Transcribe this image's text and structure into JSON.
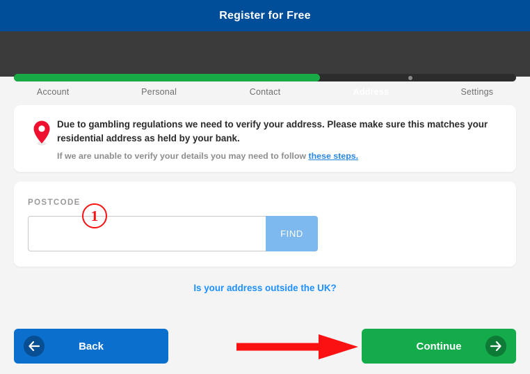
{
  "header": {
    "title": "Register for Free",
    "background_color": "#004e9a"
  },
  "stepper": {
    "progress_percent": 61,
    "steps": [
      {
        "label": "Account",
        "active": false
      },
      {
        "label": "Personal",
        "active": false
      },
      {
        "label": "Contact",
        "active": false
      },
      {
        "label": "Address",
        "active": true
      },
      {
        "label": "Settings",
        "active": false
      }
    ],
    "fill_color": "#18aa44",
    "track_color": "#2c2c2c",
    "background_color": "#3b3b3b"
  },
  "info_card": {
    "icon": "location-pin-icon",
    "icon_color": "#ef0f2e",
    "message": "Due to gambling regulations we need to verify your address. Please make sure this matches your residential address as held by your bank.",
    "sub_message_prefix": "If we are unable to verify your details you may need to follow ",
    "sub_message_link": "these steps.",
    "link_color": "#2a87e0"
  },
  "postcode_section": {
    "label": "POSTCODE",
    "input_value": "",
    "input_placeholder": "",
    "find_label": "FIND",
    "find_color": "#7db9ee"
  },
  "annotations": {
    "step_marker_1": "1",
    "marker_color": "#fb1111",
    "arrow": "red-right-arrow",
    "arrow_color": "#fb1111"
  },
  "outside_uk_link": {
    "label": "Is your address outside the UK?",
    "color": "#1e90ff"
  },
  "footer": {
    "back_label": "Back",
    "back_icon": "arrow-left-icon",
    "back_color": "#0b6fce",
    "continue_label": "Continue",
    "continue_icon": "arrow-right-icon",
    "continue_color": "#14ab4b"
  }
}
